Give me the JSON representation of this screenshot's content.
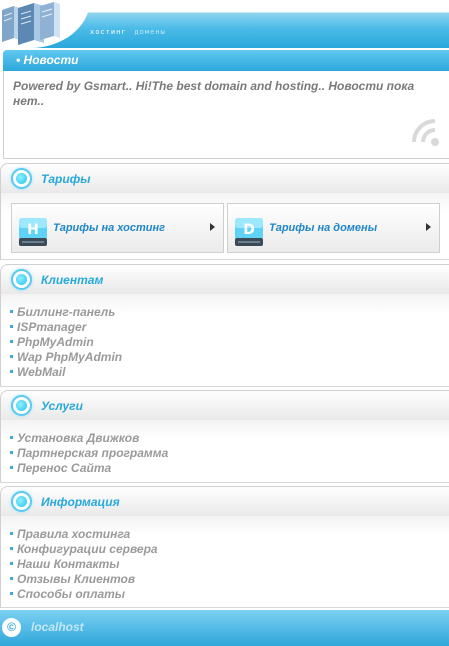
{
  "header": {
    "nav": [
      "хостинг",
      "домены"
    ]
  },
  "news": {
    "title": "• Новости",
    "text": "Powered by Gsmart.. Hi!The best domain and hosting.. Новости пока нет.."
  },
  "tariffs": {
    "title": "Тарифы",
    "hosting": {
      "letter": "H",
      "label": "Тарифы на хостинг"
    },
    "domains": {
      "letter": "D",
      "label": "Тарифы на домены"
    }
  },
  "clients": {
    "title": "Клиентам",
    "items": [
      "Биллинг-панель",
      "ISPmanager",
      "PhpMyAdmin",
      "Wap PhpMyAdmin",
      "WebMail"
    ]
  },
  "services": {
    "title": "Услуги",
    "items": [
      "Установка Движков",
      "Партнерская программа",
      "Перенос Сайта"
    ]
  },
  "info": {
    "title": "Информация",
    "items": [
      "Правила хостинга",
      "Конфигурации сервера",
      "Наши Контакты",
      "Отзывы Клиентов",
      "Способы оплаты"
    ]
  },
  "footer": {
    "copyright_symbol": "©",
    "text": "localhost"
  },
  "colors": {
    "accent": "#27a9db",
    "bar": "#2ca7dc"
  }
}
